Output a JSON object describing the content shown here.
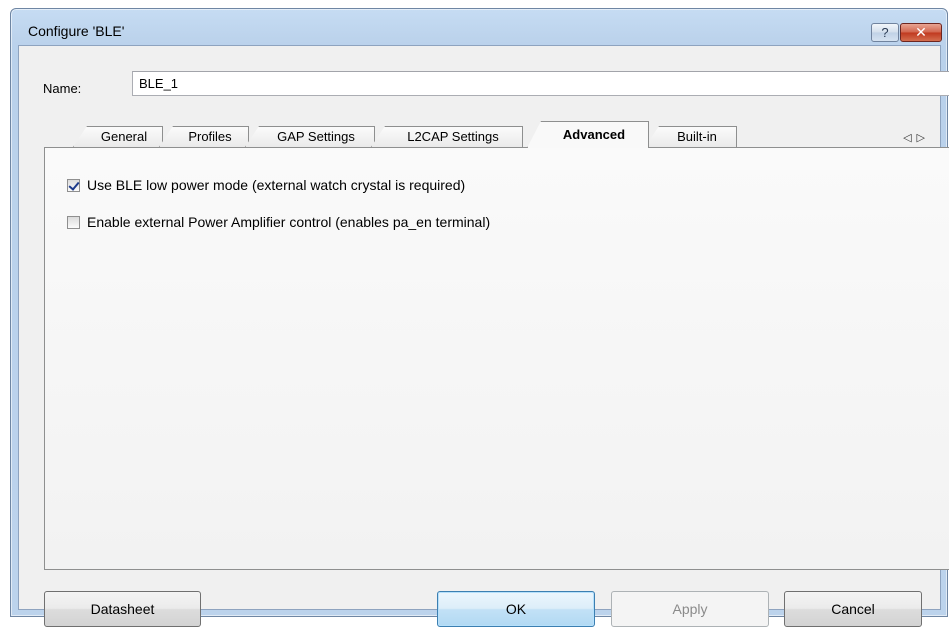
{
  "window": {
    "title": "Configure 'BLE'",
    "help_label": "?",
    "close_label": "✕"
  },
  "name_field": {
    "label": "Name:",
    "value": "BLE_1"
  },
  "tabs": [
    {
      "label": "General",
      "active": false
    },
    {
      "label": "Profiles",
      "active": false
    },
    {
      "label": "GAP Settings",
      "active": false
    },
    {
      "label": "L2CAP Settings",
      "active": false
    },
    {
      "label": "Advanced",
      "active": true
    },
    {
      "label": "Built-in",
      "active": false
    }
  ],
  "tab_scroll": {
    "left": "◁",
    "right": "▷"
  },
  "advanced": {
    "options": [
      {
        "label": "Use BLE low power mode (external watch crystal is required)",
        "checked": true
      },
      {
        "label": "Enable external Power Amplifier control (enables pa_en terminal)",
        "checked": false
      }
    ]
  },
  "buttons": {
    "datasheet": "Datasheet",
    "ok": "OK",
    "apply": "Apply",
    "cancel": "Cancel"
  }
}
